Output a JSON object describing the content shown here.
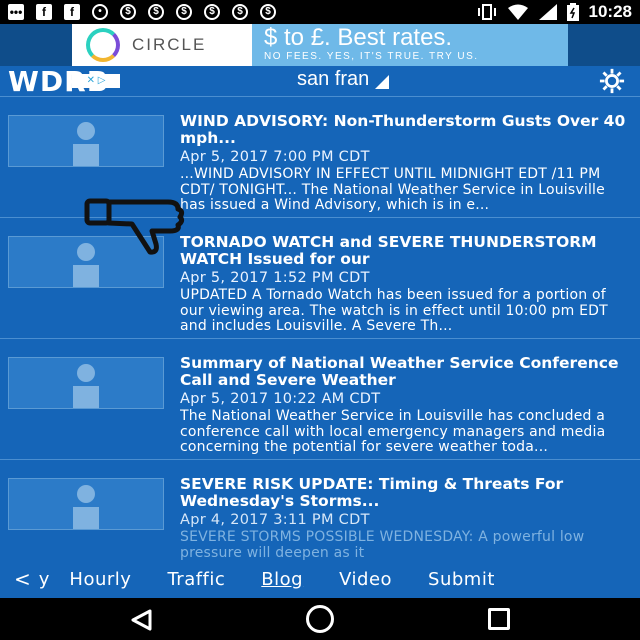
{
  "status_bar": {
    "time": "10:28",
    "icons": [
      "message-icon",
      "facebook-icon",
      "facebook-icon",
      "keyhole-icon",
      "currency-icon",
      "currency-icon",
      "currency-icon",
      "currency-icon",
      "currency-icon",
      "currency-icon",
      "vibrate-icon",
      "wifi-icon",
      "signal-icon",
      "battery-icon"
    ]
  },
  "ad": {
    "brand": "CIRCLE",
    "headline": "$ to £. Best rates.",
    "subline": "NO FEES. YES, IT'S TRUE. TRY US."
  },
  "header": {
    "logo": "WDRB",
    "location": "san fran",
    "settings_icon": "gear-icon"
  },
  "articles": [
    {
      "title": "WIND ADVISORY: Non-Thunderstorm Gusts Over 40 mph...",
      "date": "Apr 5, 2017 7:00 PM CDT",
      "body": "...WIND ADVISORY IN EFFECT UNTIL MIDNIGHT EDT /11 PM CDT/ TONIGHT... The National Weather Service in Louisville has issued a Wind Advisory, which is in e..."
    },
    {
      "title": "TORNADO WATCH and SEVERE THUNDERSTORM WATCH Issued for our",
      "date": "Apr 5, 2017 1:52 PM CDT",
      "body": "UPDATED A Tornado Watch has been issued for a portion of our viewing area. The watch is in effect until 10:00 pm EDT and includes Louisville. A Severe Th..."
    },
    {
      "title": "Summary of National Weather Service Conference Call and Severe Weather",
      "date": "Apr 5, 2017 10:22 AM CDT",
      "body": "The National Weather Service in Louisville has concluded a conference call with local emergency managers and media concerning the potential for severe weather toda..."
    },
    {
      "title": "SEVERE RISK UPDATE: Timing & Threats For Wednesday's Storms...",
      "date": "Apr 4, 2017 3:11 PM CDT",
      "body": "SEVERE STORMS POSSIBLE WEDNESDAY: A powerful low pressure will deepen as it"
    }
  ],
  "tabs": {
    "back": "<",
    "partial": "y",
    "items": [
      "Hourly",
      "Traffic",
      "Blog",
      "Video",
      "Submit"
    ],
    "active": "Blog"
  }
}
